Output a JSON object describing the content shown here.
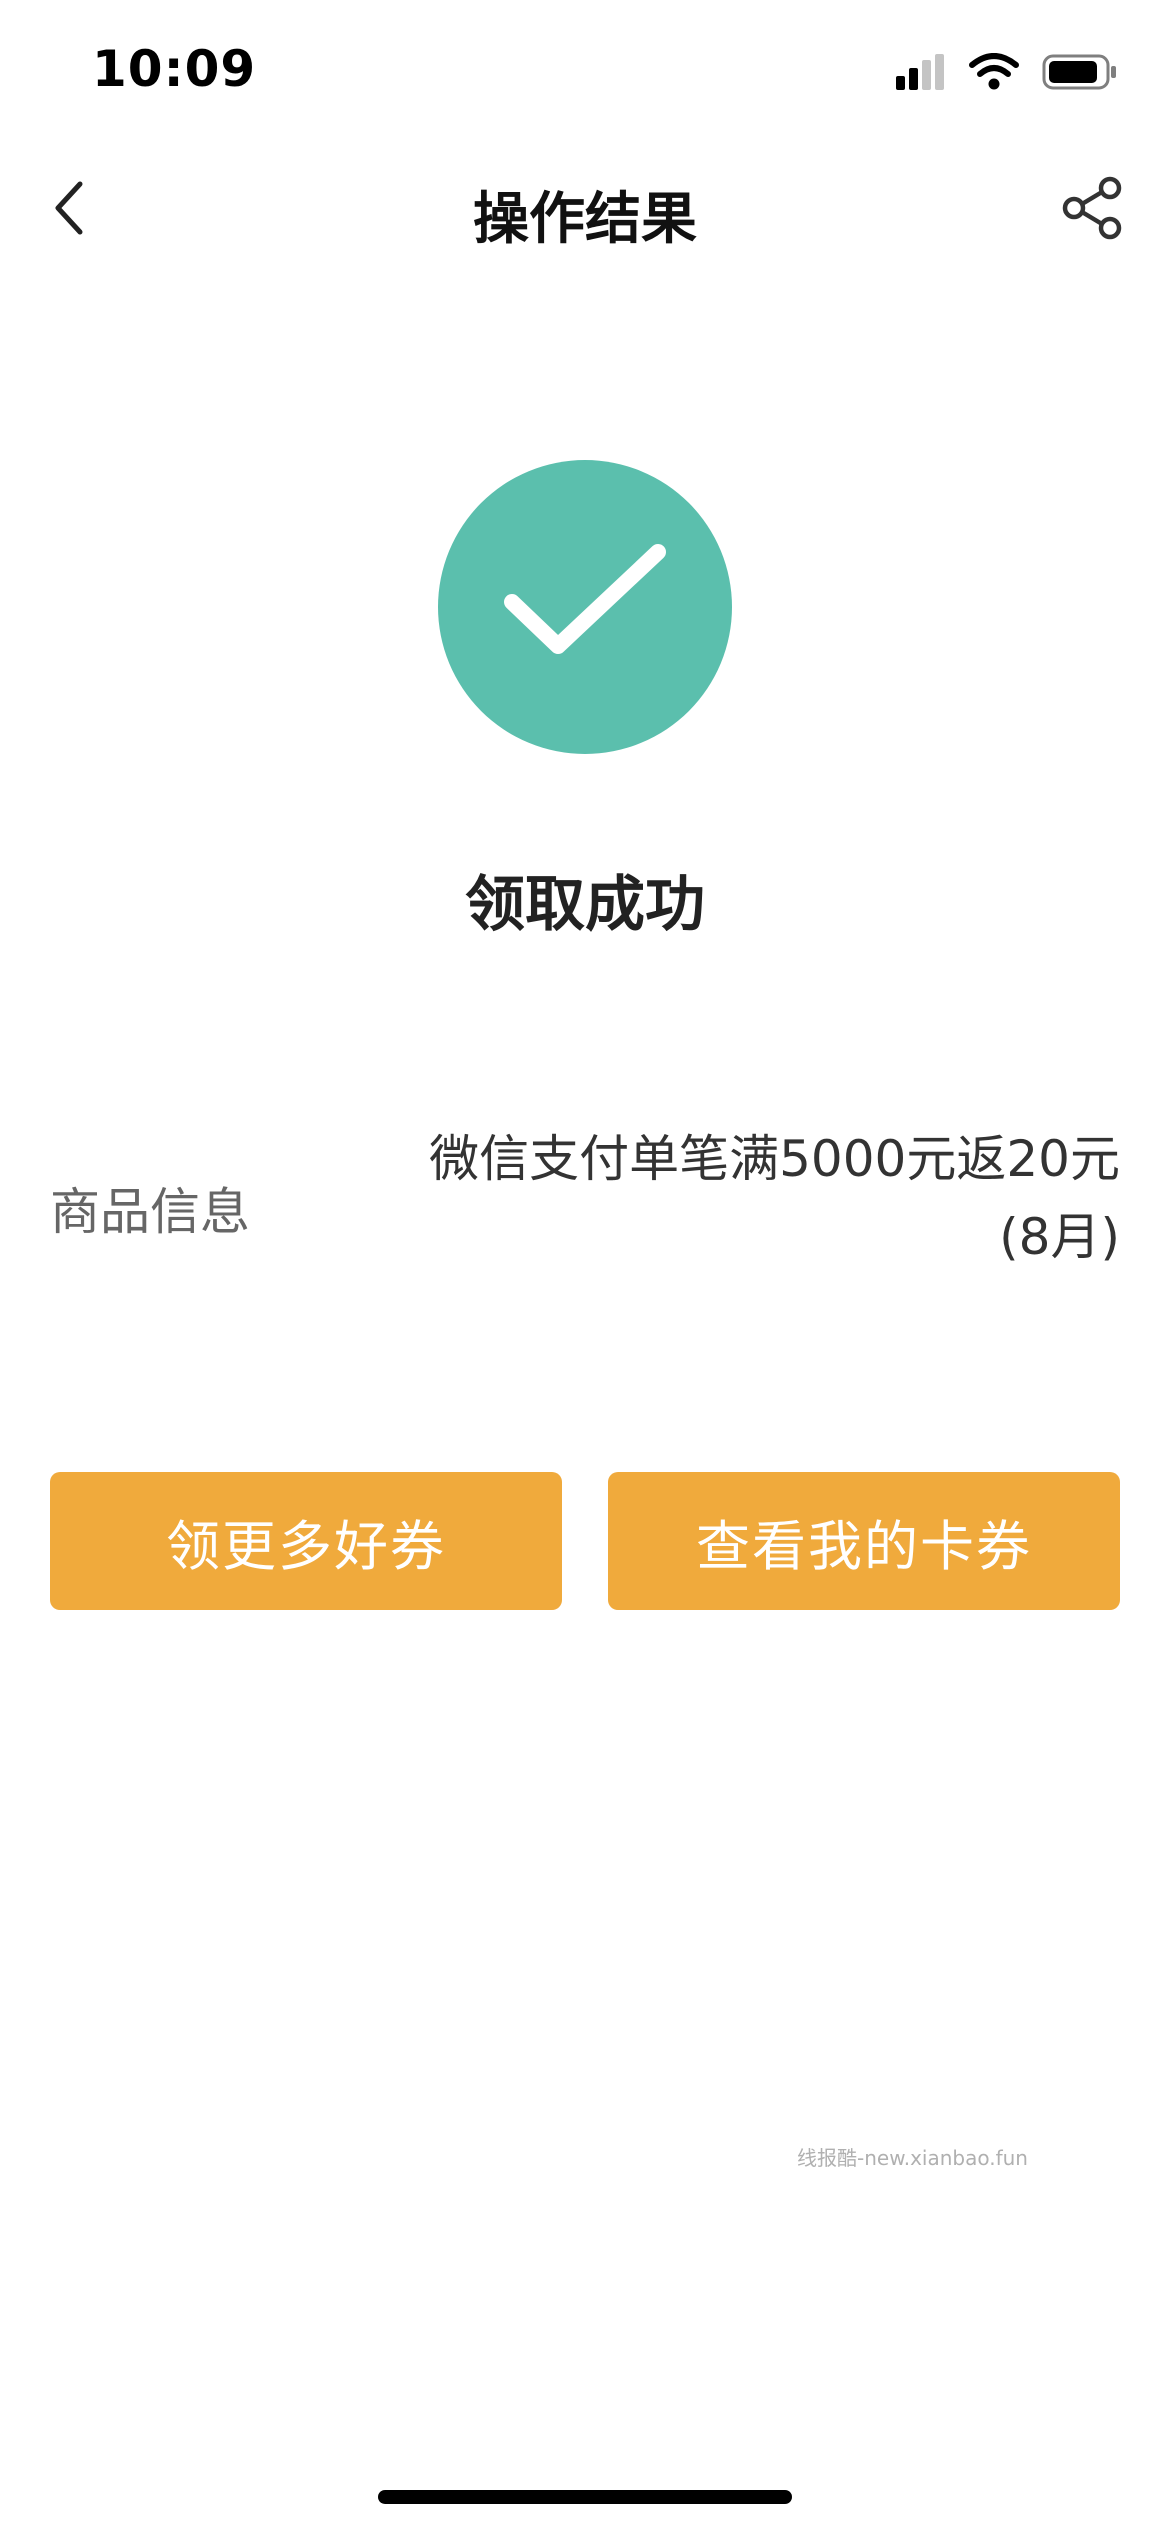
{
  "status_bar": {
    "time": "10:09",
    "icons": [
      "signal-icon",
      "wifi-icon",
      "battery-icon"
    ]
  },
  "nav": {
    "title": "操作结果",
    "back_icon": "chevron-left-icon",
    "share_icon": "share-icon"
  },
  "result": {
    "status_icon": "checkmark-icon",
    "status_text": "领取成功"
  },
  "info": {
    "label": "商品信息",
    "value_line1": "微信支付单笔满5000元返20元",
    "value_line2": "(8月)"
  },
  "actions": {
    "more_coupons_label": "领更多好券",
    "view_coupons_label": "查看我的卡券"
  },
  "watermark": "线报酷-new.xianbao.fun",
  "colors": {
    "success": "#5bbfad",
    "button": "#f0aa3c",
    "background": "#ffffff"
  }
}
